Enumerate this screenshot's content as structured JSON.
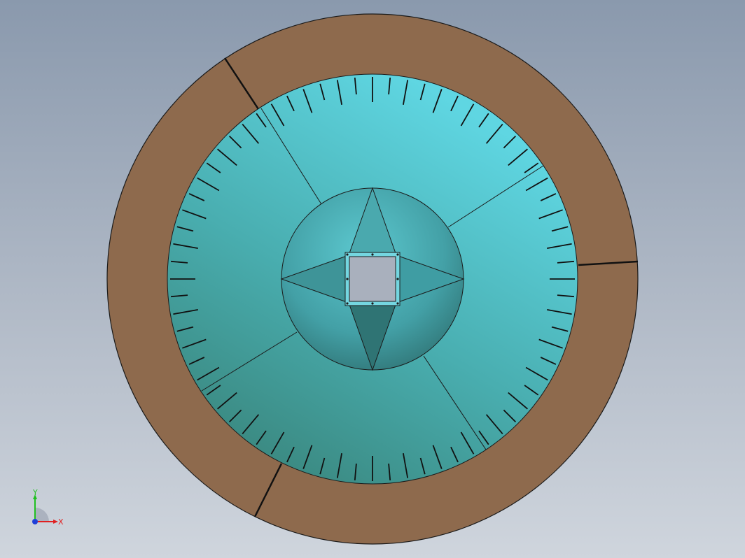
{
  "viewport": {
    "background_top": "#8a99ad",
    "background_bottom": "#cfd5dd"
  },
  "model": {
    "outer_ring_color": "#8e6a4d",
    "dial_color_light": "#5fd6e2",
    "dial_color_dark": "#3a8d86",
    "hub_color": "#49a6ad",
    "square_port_color": "#a9b0bd",
    "frame_color": "#74d6e0",
    "tick_count": 72
  },
  "triad": {
    "x_label": "X",
    "y_label": "Y",
    "x_color": "#e02020",
    "y_color": "#20c020",
    "z_color": "#1f3fd8"
  }
}
